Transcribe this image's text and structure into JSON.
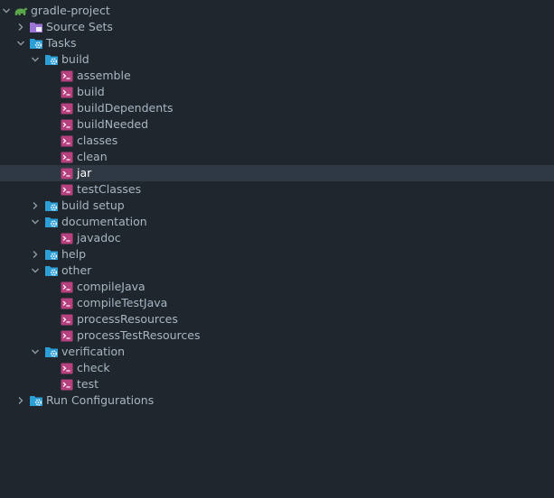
{
  "colors": {
    "background": "#1f262d",
    "selection": "#2f3943",
    "text": "#a8b6c3",
    "folder": "#2c9fd6",
    "gear": "#e6f2fb",
    "source_sets_folder": "#9b74d6",
    "task_icon": "#b7407f",
    "gradle_icon": "#5aa64a"
  },
  "tree": {
    "root": {
      "label": "gradle-project",
      "icon": "gradle-elephant-icon",
      "expanded": true
    },
    "source_sets": {
      "label": "Source Sets",
      "icon": "source-sets-folder-icon",
      "expanded": false
    },
    "tasks": {
      "label": "Tasks",
      "icon": "tasks-folder-icon",
      "expanded": true
    },
    "groups": [
      {
        "label": "build",
        "expanded": true,
        "tasks": [
          "assemble",
          "build",
          "buildDependents",
          "buildNeeded",
          "classes",
          "clean",
          "jar",
          "testClasses"
        ],
        "selected_task": "jar"
      },
      {
        "label": "build setup",
        "expanded": false,
        "tasks": []
      },
      {
        "label": "documentation",
        "expanded": true,
        "tasks": [
          "javadoc"
        ]
      },
      {
        "label": "help",
        "expanded": false,
        "tasks": []
      },
      {
        "label": "other",
        "expanded": true,
        "tasks": [
          "compileJava",
          "compileTestJava",
          "processResources",
          "processTestResources"
        ]
      },
      {
        "label": "verification",
        "expanded": true,
        "tasks": [
          "check",
          "test"
        ]
      }
    ],
    "run_configurations": {
      "label": "Run Configurations",
      "icon": "run-configurations-folder-icon",
      "expanded": false
    }
  }
}
